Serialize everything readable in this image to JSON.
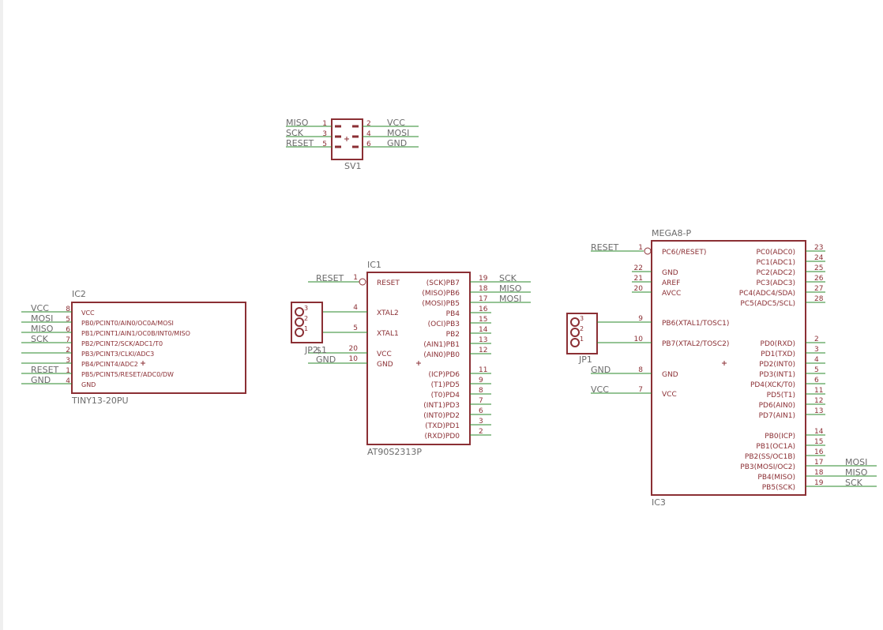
{
  "colors": {
    "body": "#8b2f34",
    "wire": "#2b8a2b",
    "label": "#6b6b6b",
    "background": "#ffffff"
  },
  "sv1": {
    "name": "SV1",
    "left": [
      [
        "MISO",
        "1"
      ],
      [
        "SCK",
        "3"
      ],
      [
        "RESET",
        "5"
      ]
    ],
    "right": [
      [
        "2",
        "VCC"
      ],
      [
        "4",
        "MOSI"
      ],
      [
        "6",
        "GND"
      ]
    ]
  },
  "ic2": {
    "name": "IC2",
    "value": "TINY13-20PU",
    "pins": [
      [
        "VCC",
        "8",
        "VCC"
      ],
      [
        "MOSI",
        "5",
        "PB0/PCINT0/AIN0/OC0A/MOSI"
      ],
      [
        "MISO",
        "6",
        "PB1/PCINT1/AIN1/OC0B/INT0/MISO"
      ],
      [
        "SCK",
        "7",
        "PB2/PCINT2/SCK/ADC1/T0"
      ],
      [
        "",
        "2",
        "PB3/PCINT3/CLKI/ADC3"
      ],
      [
        "",
        "3",
        "PB4/PCINT4/ADC2"
      ],
      [
        "RESET",
        "1",
        "PB5/PCINT5/RESET/ADC0/DW"
      ],
      [
        "GND",
        "4",
        "GND"
      ]
    ]
  },
  "ic1": {
    "name": "IC1",
    "value": "AT90S2313P",
    "left": [
      [
        "RESET",
        "1",
        "RESET"
      ],
      [
        "",
        "4",
        "XTAL2"
      ],
      [
        "",
        "5",
        "XTAL1"
      ],
      [
        "",
        "20",
        "VCC"
      ],
      [
        "GND",
        "10",
        "GND"
      ]
    ],
    "right": [
      [
        "(SCK)PB7",
        "19",
        "SCK"
      ],
      [
        "(MISO)PB6",
        "18",
        "MISO"
      ],
      [
        "(MOSI)PB5",
        "17",
        "MOSI"
      ],
      [
        "PB4",
        "16",
        ""
      ],
      [
        "(OCI)PB3",
        "15",
        ""
      ],
      [
        "PB2",
        "14",
        ""
      ],
      [
        "(AIN1)PB1",
        "13",
        ""
      ],
      [
        "(AIN0)PB0",
        "12",
        ""
      ],
      [
        "(ICP)PD6",
        "11",
        ""
      ],
      [
        "(T1)PD5",
        "9",
        ""
      ],
      [
        "(T0)PD4",
        "8",
        ""
      ],
      [
        "(INT1)PD3",
        "7",
        ""
      ],
      [
        "(INT0)PD2",
        "6",
        ""
      ],
      [
        "(TXD)PD1",
        "3",
        ""
      ],
      [
        "(RXD)PD0",
        "2",
        ""
      ]
    ]
  },
  "jp2": {
    "name": "JP2",
    "overlap": "$1",
    "pins": [
      "3",
      "2",
      "1"
    ]
  },
  "jp1": {
    "name": "JP1",
    "pins": [
      "3",
      "2",
      "1"
    ]
  },
  "ic3": {
    "name": "IC3",
    "value": "MEGA8-P",
    "left": [
      [
        "RESET",
        "1",
        "PC6(/RESET)"
      ],
      [
        "",
        "22",
        "GND"
      ],
      [
        "",
        "21",
        "AREF"
      ],
      [
        "",
        "20",
        "AVCC"
      ],
      [
        "",
        "9",
        "PB6(XTAL1/TOSC1)"
      ],
      [
        "",
        "10",
        "PB7(XTAL2/TOSC2)"
      ],
      [
        "GND",
        "8",
        "GND"
      ],
      [
        "VCC",
        "7",
        "VCC"
      ]
    ],
    "right": [
      [
        "PC0(ADC0)",
        "23",
        ""
      ],
      [
        "PC1(ADC1)",
        "24",
        ""
      ],
      [
        "PC2(ADC2)",
        "25",
        ""
      ],
      [
        "PC3(ADC3)",
        "26",
        ""
      ],
      [
        "PC4(ADC4/SDA)",
        "27",
        ""
      ],
      [
        "PC5(ADC5/SCL)",
        "28",
        ""
      ],
      [
        "PD0(RXD)",
        "2",
        ""
      ],
      [
        "PD1(TXD)",
        "3",
        ""
      ],
      [
        "PD2(INT0)",
        "4",
        ""
      ],
      [
        "PD3(INT1)",
        "5",
        ""
      ],
      [
        "PD4(XCK/T0)",
        "6",
        ""
      ],
      [
        "PD5(T1)",
        "11",
        ""
      ],
      [
        "PD6(AIN0)",
        "12",
        ""
      ],
      [
        "PD7(AIN1)",
        "13",
        ""
      ],
      [
        "PB0(ICP)",
        "14",
        ""
      ],
      [
        "PB1(OC1A)",
        "15",
        ""
      ],
      [
        "PB2(SS/OC1B)",
        "16",
        ""
      ],
      [
        "PB3(MOSI/OC2)",
        "17",
        "MOSI"
      ],
      [
        "PB4(MISO)",
        "18",
        "MISO"
      ],
      [
        "PB5(SCK)",
        "19",
        "SCK"
      ]
    ]
  }
}
